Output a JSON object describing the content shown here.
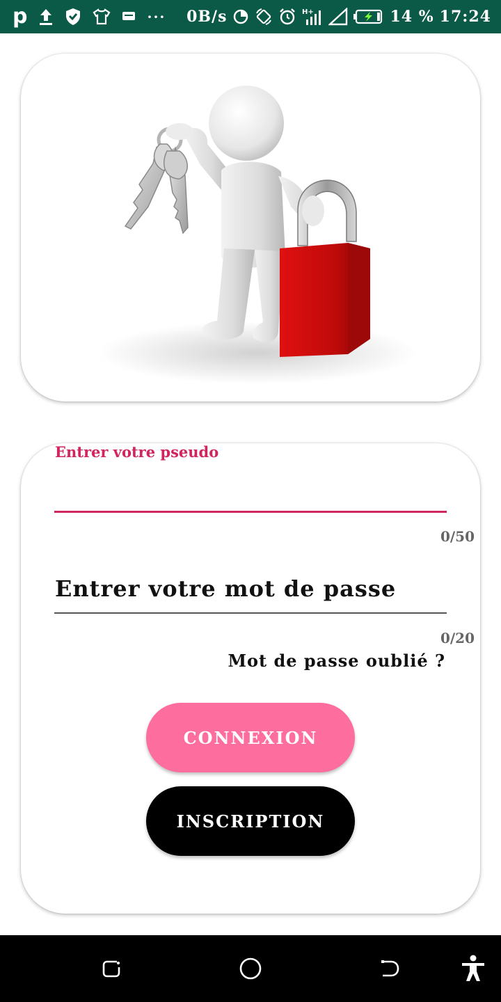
{
  "status_bar": {
    "net_speed": "0B/s",
    "battery_percent": "14 %",
    "time": "17:24",
    "icons": [
      "p-app-icon",
      "upload-icon",
      "shield-icon",
      "tshirt-icon",
      "message-icon",
      "more-dots-icon",
      "data-saver-icon",
      "rotate-icon",
      "alarm-icon",
      "signal-h-plus-icon",
      "signal-icon",
      "battery-charging-icon"
    ],
    "color": "#0b5a48"
  },
  "hero": {
    "image_icon": "3d-person-keys-padlock-illustration"
  },
  "form": {
    "username": {
      "label": "Entrer votre pseudo",
      "value": "",
      "counter": "0/50",
      "accent_color": "#d1255e"
    },
    "password": {
      "placeholder": "Entrer votre mot de passe",
      "value": "",
      "counter": "0/20"
    },
    "forgot_link": "Mot de passe oublié ?",
    "login_button": "CONNEXION",
    "login_color": "#fd6d9e",
    "signup_button": "INSCRIPTION",
    "signup_color": "#000000"
  },
  "nav_bar": {
    "icons": [
      "recent-apps-icon",
      "home-icon",
      "back-icon",
      "accessibility-icon"
    ]
  }
}
